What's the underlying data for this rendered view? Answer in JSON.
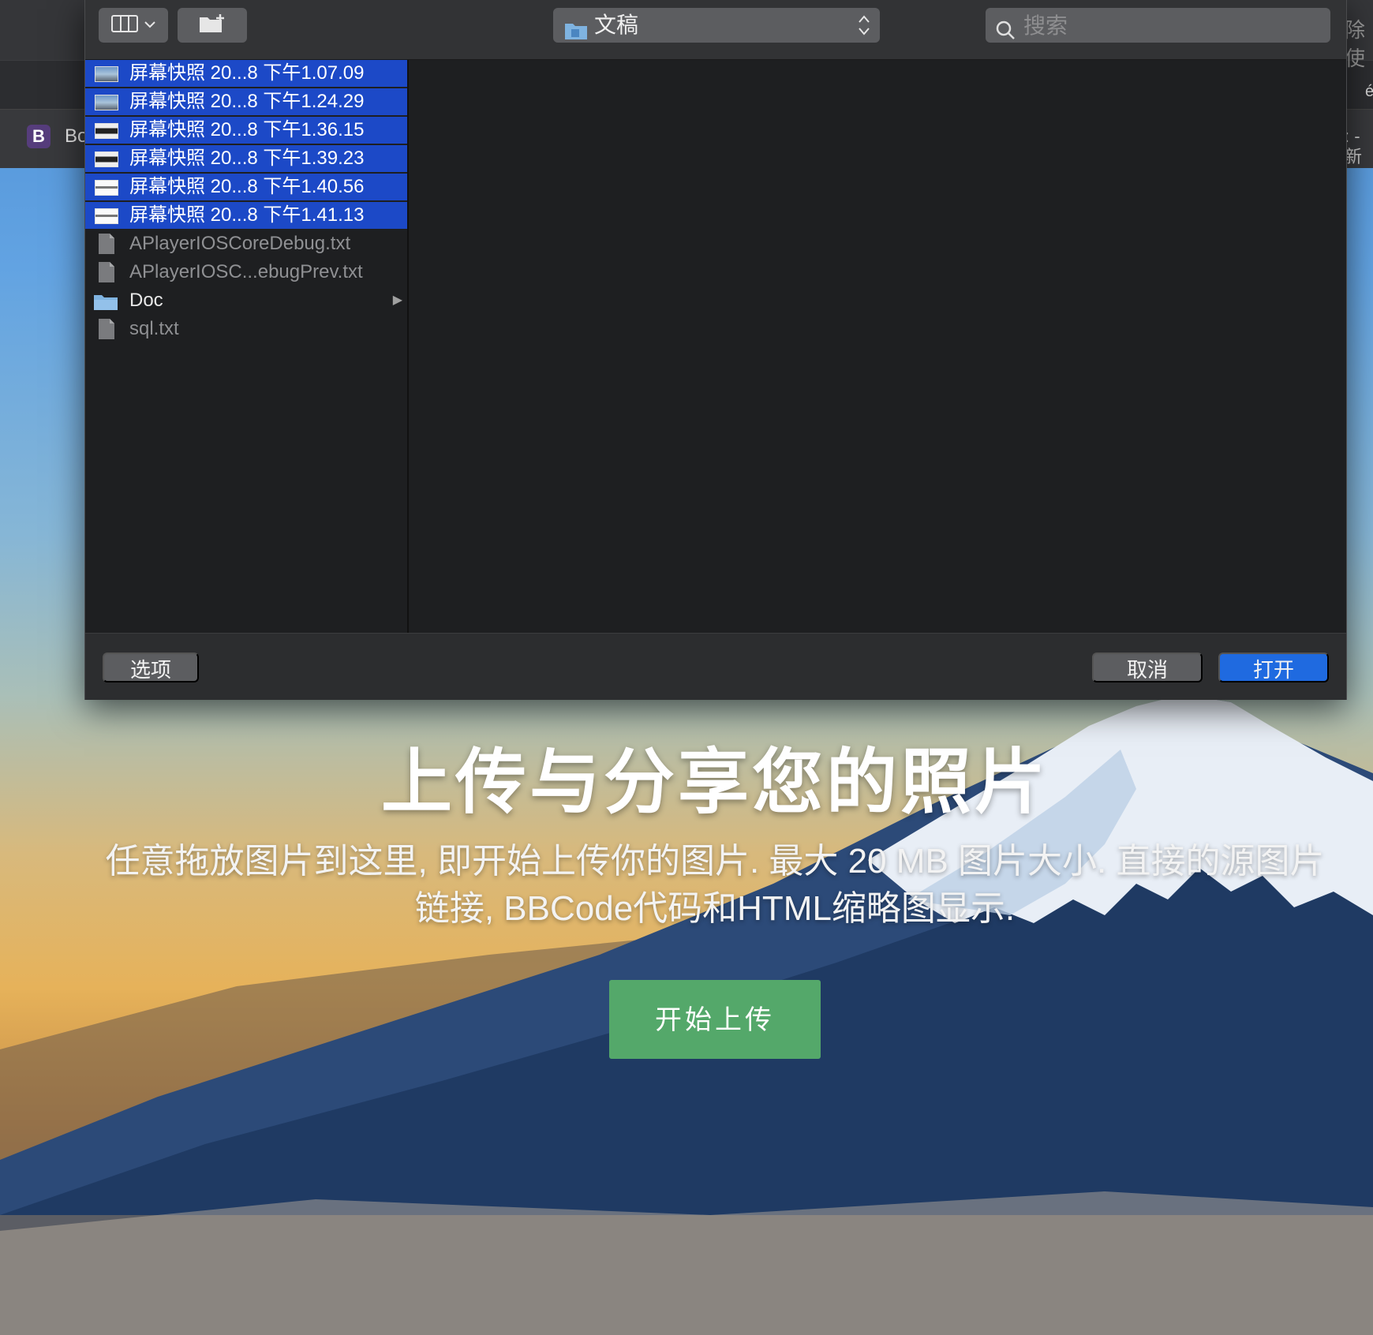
{
  "browser": {
    "tab_title": "Bo",
    "tab_favicon_letter": "B",
    "edge_text_top": "除使",
    "edge_text_tab": ": - 新",
    "edge_text_mid": "é"
  },
  "hero": {
    "title": "上传与分享您的照片",
    "description": "任意拖放图片到这里, 即开始上传你的图片. 最大 20 MB 图片大小. 直接的源图片链接, BBCode代码和HTML缩略图显示.",
    "upload_button": "开始上传"
  },
  "dialog": {
    "toolbar": {
      "view_icon": "column-view-icon",
      "new_folder_icon": "new-folder-icon",
      "location": "文稿",
      "search_placeholder": "搜索",
      "search_value": ""
    },
    "files": [
      {
        "name": "屏幕快照 20...8 下午1.07.09",
        "kind": "image",
        "selected": true,
        "thumb": "img"
      },
      {
        "name": "屏幕快照 20...8 下午1.24.29",
        "kind": "image",
        "selected": true,
        "thumb": "img"
      },
      {
        "name": "屏幕快照 20...8 下午1.36.15",
        "kind": "image",
        "selected": true,
        "thumb": "dark"
      },
      {
        "name": "屏幕快照 20...8 下午1.39.23",
        "kind": "image",
        "selected": true,
        "thumb": "dark"
      },
      {
        "name": "屏幕快照 20...8 下午1.40.56",
        "kind": "image",
        "selected": true,
        "thumb": "light"
      },
      {
        "name": "屏幕快照 20...8 下午1.41.13",
        "kind": "image",
        "selected": true,
        "thumb": "light"
      },
      {
        "name": "APlayerIOSCoreDebug.txt",
        "kind": "text",
        "selected": false
      },
      {
        "name": "APlayerIOSC...ebugPrev.txt",
        "kind": "text",
        "selected": false
      },
      {
        "name": "Doc",
        "kind": "folder",
        "selected": false
      },
      {
        "name": "sql.txt",
        "kind": "text",
        "selected": false
      }
    ],
    "buttons": {
      "options": "选项",
      "cancel": "取消",
      "open": "打开"
    }
  },
  "colors": {
    "selection": "#1c49c7",
    "open_button": "#1f6ae0",
    "upload_button": "#54a86a"
  }
}
